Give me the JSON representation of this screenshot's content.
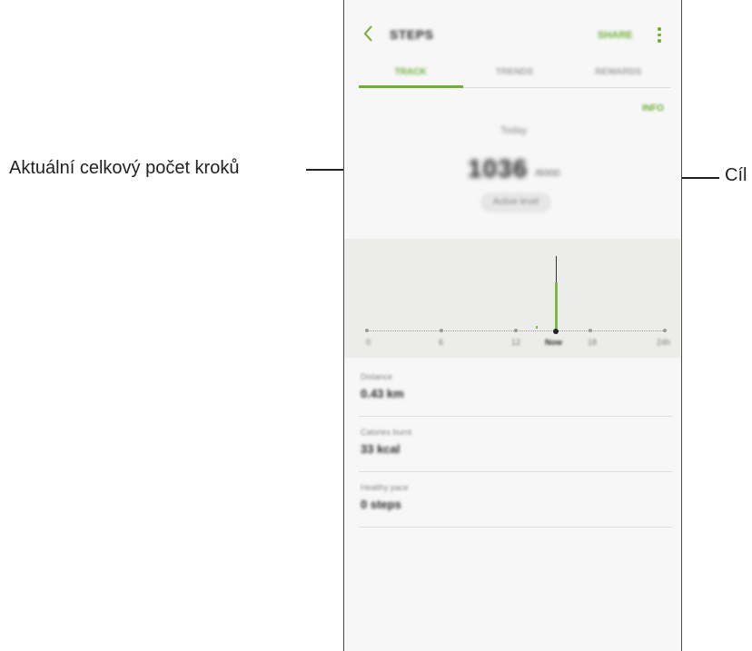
{
  "callouts": {
    "left": "Aktuální celkový počet kroků",
    "right": "Cíl"
  },
  "app": {
    "title": "STEPS",
    "share_label": "SHARE",
    "back_icon": "chevron-left-icon",
    "more_icon": "more-vertical-icon",
    "tabs": [
      {
        "label": "TRACK",
        "active": true
      },
      {
        "label": "TRENDS",
        "active": false
      },
      {
        "label": "REWARDS",
        "active": false
      }
    ],
    "info_label": "INFO",
    "date_label": "Today",
    "step_total": "1036",
    "step_goal": "/6000",
    "level_label": "Active level",
    "graph": {
      "ticks": [
        "0",
        "6",
        "12",
        "Now",
        "18",
        "24h"
      ],
      "current_tick_index": 3
    },
    "stats": [
      {
        "label": "Distance",
        "value": "0.43 km"
      },
      {
        "label": "Calories burnt",
        "value": "33 kcal"
      },
      {
        "label": "Healthy pace",
        "value": "0 steps"
      }
    ]
  },
  "colors": {
    "accent": "#6fae37",
    "bar": "#79b94a",
    "graph_background": "#ececea"
  }
}
